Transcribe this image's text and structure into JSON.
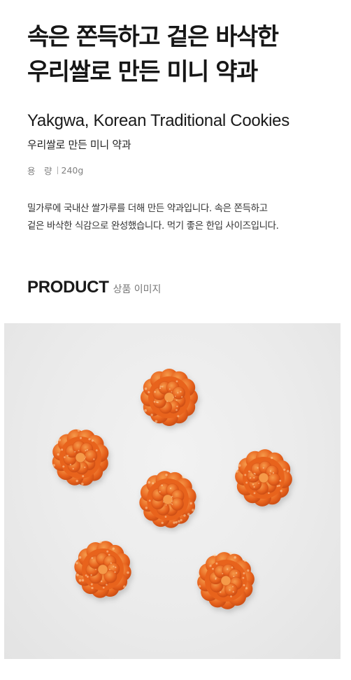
{
  "headline": {
    "line1": "속은 쫀득하고 겉은 바삭한",
    "line2": "우리쌀로 만든 미니 약과"
  },
  "product": {
    "english_name": "Yakgwa, Korean Traditional Cookies",
    "korean_name": "우리쌀로 만든 미니 약과",
    "spec_label": "용　량",
    "spec_value": "240g"
  },
  "description": {
    "line1": "밀가루에 국내산 쌀가루를 더해 만든 약과입니다. 속은 쫀득하고",
    "line2": "겉은 바삭한 식감으로 완성했습니다. 먹기 좋은 한입 사이즈입니다."
  },
  "section": {
    "title_en": "PRODUCT",
    "title_ko": "상품 이미지"
  },
  "image": {
    "subject": "yakgwa-cookies",
    "count": 6,
    "background_color": "#ebebeb",
    "cookie_colors": {
      "base": "#e8641f",
      "light": "#f59a4a",
      "dark": "#c84a12"
    }
  }
}
